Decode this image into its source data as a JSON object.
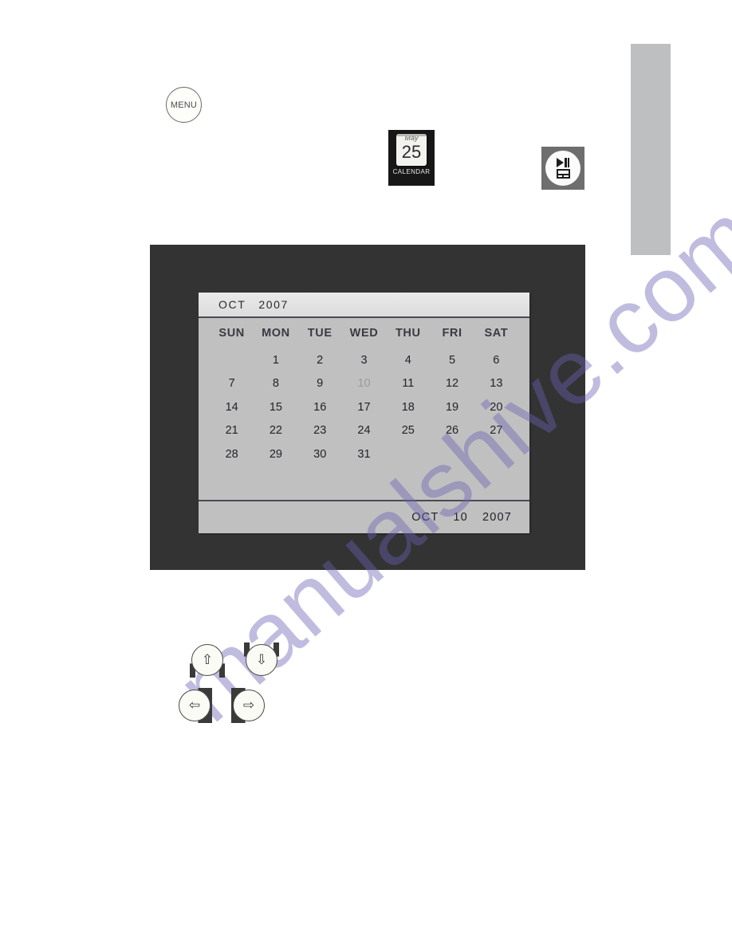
{
  "watermark": {
    "text": "manualshive.com"
  },
  "menu_button": {
    "label": "MENU",
    "icon": "menu-circle-icon"
  },
  "calendar_icon": {
    "month": "May",
    "day": "25",
    "caption": "CALENDAR",
    "icon": "calendar-icon"
  },
  "slideshow_button": {
    "icon": "play-pause-slideshow-icon"
  },
  "screen": {
    "panel": {
      "titlebar": {
        "month": "OCT",
        "year": "2007"
      },
      "weekdays": [
        "SUN",
        "MON",
        "TUE",
        "WED",
        "THU",
        "FRI",
        "SAT"
      ],
      "weeks": [
        [
          "",
          "1",
          "2",
          "3",
          "4",
          "5",
          "6"
        ],
        [
          "7",
          "8",
          "9",
          "10",
          "11",
          "12",
          "13"
        ],
        [
          "14",
          "15",
          "16",
          "17",
          "18",
          "19",
          "20"
        ],
        [
          "21",
          "22",
          "23",
          "24",
          "25",
          "26",
          "27"
        ],
        [
          "28",
          "29",
          "30",
          "31",
          "",
          "",
          ""
        ]
      ],
      "selected_day": "10",
      "footer": {
        "month": "OCT",
        "day": "10",
        "year": "2007"
      }
    },
    "colors": {
      "bezel": "#333333",
      "panel_bg": "#c0c0c0",
      "titlebar_bg": "#e4e4e4",
      "date_text": "#22222a",
      "selected_date_text": "#9a9aa2",
      "divider": "#4a4a55"
    }
  },
  "dpad": {
    "up": {
      "glyph": "⇧",
      "icon": "arrow-up-icon"
    },
    "down": {
      "glyph": "⇩",
      "icon": "arrow-down-icon"
    },
    "left": {
      "glyph": "⇦",
      "icon": "arrow-left-icon"
    },
    "right": {
      "glyph": "⇨",
      "icon": "arrow-right-icon"
    }
  },
  "side_tab": {
    "color": "#bdbfc1"
  }
}
